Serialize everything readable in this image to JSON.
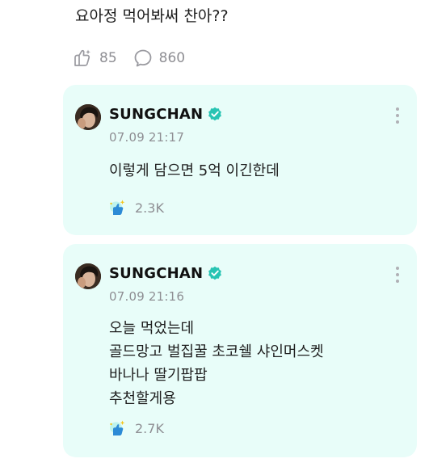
{
  "fan_post": {
    "text": "요아정 먹어봐써 찬아??",
    "like_count": "85",
    "comment_count": "860"
  },
  "replies": [
    {
      "author": "SUNGCHAN",
      "timestamp": "07.09 21:17",
      "lines": [
        "이렇게 담으면 5억 이긴한데"
      ],
      "like_count": "2.3K"
    },
    {
      "author": "SUNGCHAN",
      "timestamp": "07.09 21:16",
      "lines": [
        "오늘 먹었는데",
        "골드망고 벌집꿀 초코쉘 샤인머스켓",
        "바나나 딸기팝팝",
        "추천할게용"
      ],
      "like_count": "2.7K"
    }
  ],
  "colors": {
    "card_background": "#e8fdf9",
    "verified_badge": "#28c4b3",
    "secondary_text": "#8e8e93"
  },
  "icons": {
    "fan_like": "sparkle-hand-like-icon",
    "fan_comment": "speech-bubble-icon",
    "verified": "verified-badge-icon",
    "more": "more-vertical-icon",
    "reply_like": "colored-like-icon"
  }
}
